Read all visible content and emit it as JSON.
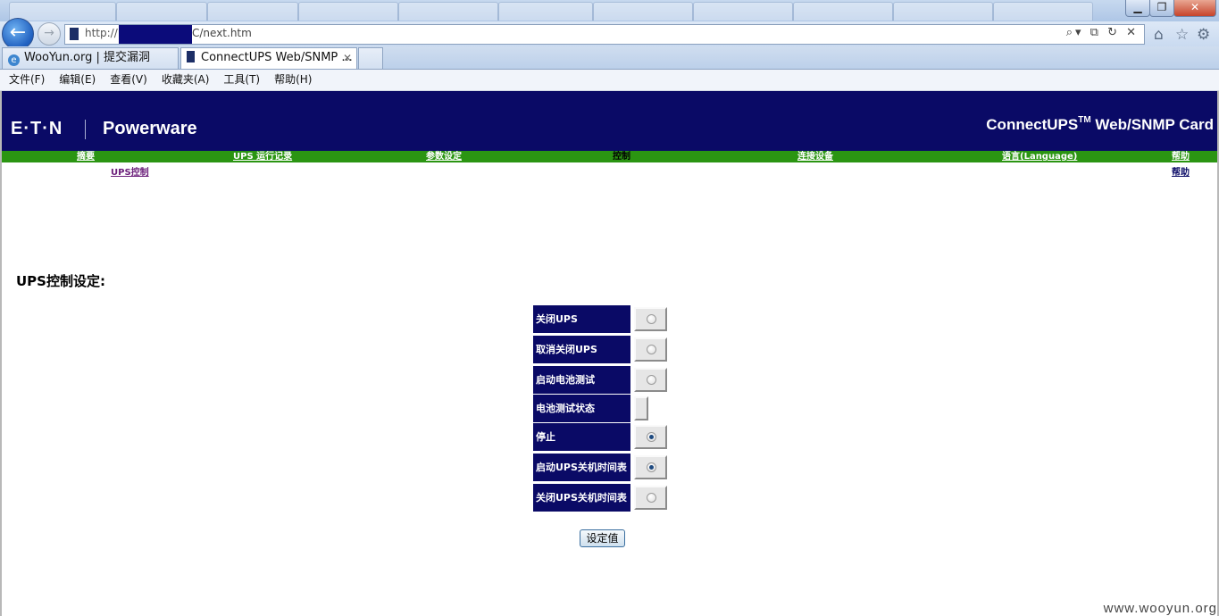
{
  "browser": {
    "address_prefix": "http://",
    "address_suffix": "C/next.htm",
    "tabs": [
      {
        "label": "WooYun.org | 提交漏洞"
      },
      {
        "label": "ConnectUPS Web/SNMP ..."
      }
    ],
    "menu": [
      "文件(F)",
      "编辑(E)",
      "查看(V)",
      "收藏夹(A)",
      "工具(T)",
      "帮助(H)"
    ]
  },
  "header": {
    "brand": "E·T·N",
    "brand2": "Powerware",
    "product_main": "ConnectUPS",
    "product_tm": "TM",
    "product_rest": " Web/SNMP Card"
  },
  "nav": [
    {
      "label": "摘要"
    },
    {
      "label": "UPS 运行记录"
    },
    {
      "label": "参数设定"
    },
    {
      "label": "控制"
    },
    {
      "label": "连接设备"
    },
    {
      "label": "语言(Language)"
    },
    {
      "label": "帮助"
    }
  ],
  "subnav": {
    "left": "UPS控制",
    "right": "帮助"
  },
  "section_title": "UPS控制设定:",
  "controls": [
    {
      "label": "关闭UPS",
      "type": "radio",
      "checked": false
    },
    {
      "label": "取消关闭UPS",
      "type": "radio",
      "checked": false
    },
    {
      "label": "启动电池测试",
      "type": "radio",
      "checked": false
    },
    {
      "label": "电池测试状态",
      "type": "status",
      "checked": false
    },
    {
      "label": "停止",
      "type": "radio",
      "checked": true
    },
    {
      "label": "启动UPS关机时间表",
      "type": "radio",
      "checked": true
    },
    {
      "label": "关闭UPS关机时间表",
      "type": "radio",
      "checked": false
    }
  ],
  "submit_label": "设定值",
  "watermark": "www.wooyun.org",
  "colors": {
    "banner": "#0a0a66",
    "nav_bar": "#2b9512",
    "link_purple": "#6b1e7a"
  }
}
